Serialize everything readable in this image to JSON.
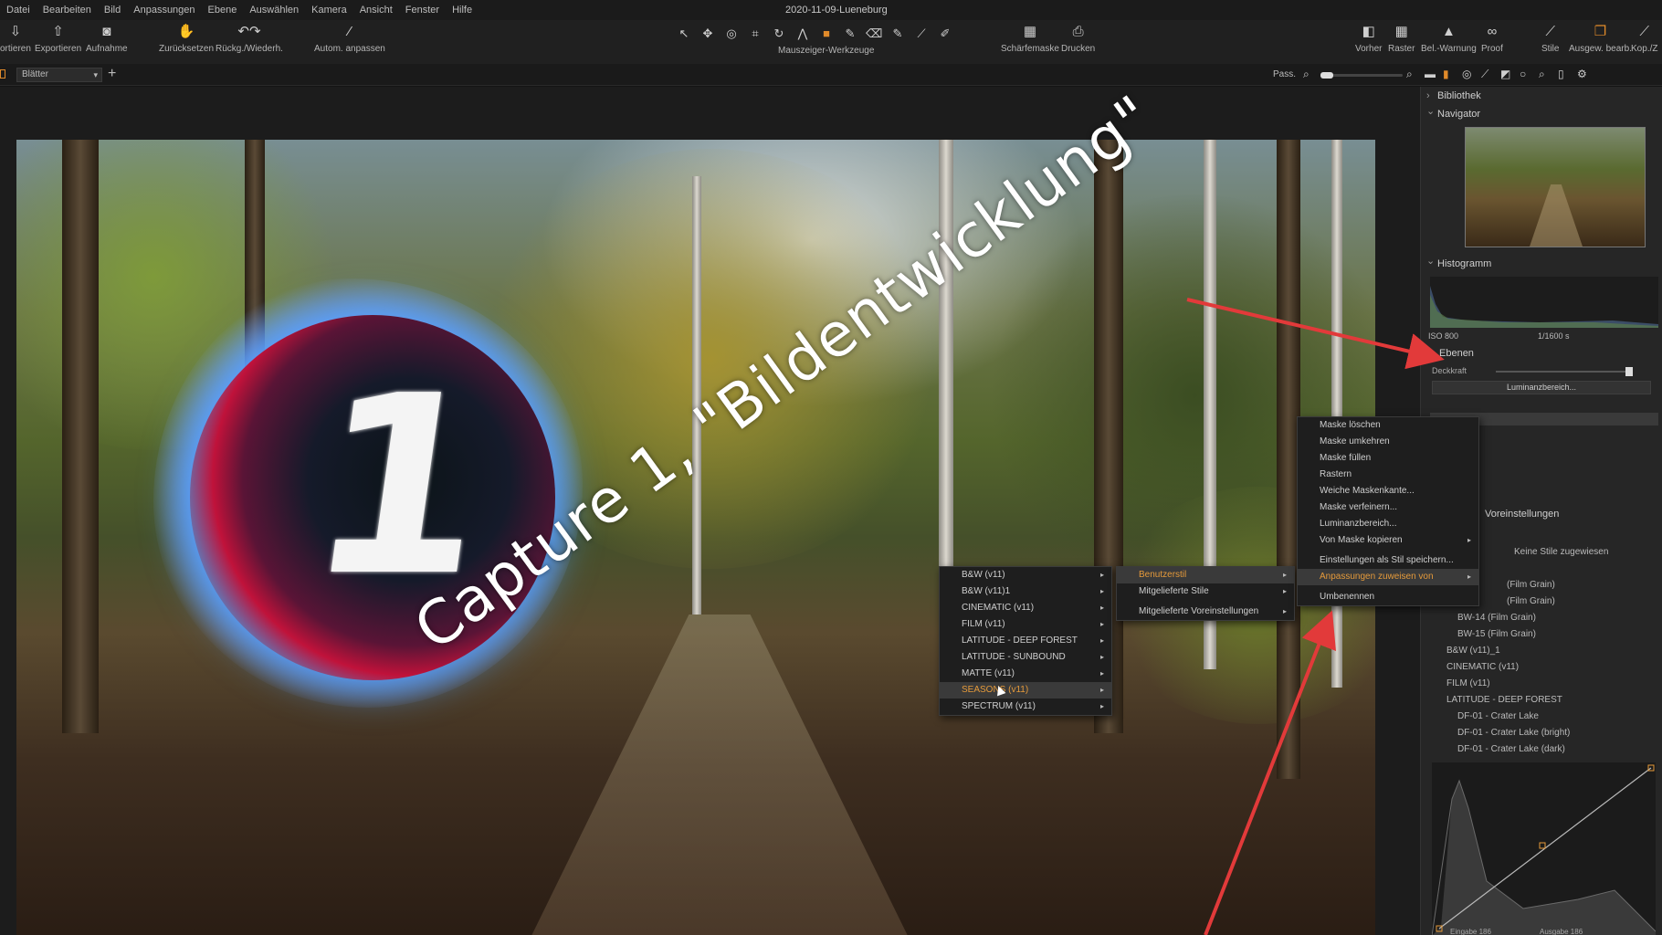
{
  "menubar": {
    "items": [
      "Datei",
      "Bearbeiten",
      "Bild",
      "Anpassungen",
      "Ebene",
      "Auswählen",
      "Kamera",
      "Ansicht",
      "Fenster",
      "Hilfe"
    ],
    "doc_title": "2020-11-09-Lueneburg"
  },
  "toolbar": {
    "import": "ortieren",
    "export": "Exportieren",
    "capture": "Aufnahme",
    "reset": "Zurücksetzen",
    "undo_redo": "Rückg./Wiederh.",
    "auto": "Autom. anpassen",
    "cursor_tools": "Mauszeiger-Werkzeuge",
    "focus_mask": "Schärfemaske",
    "print": "Drucken",
    "before": "Vorher",
    "grid": "Raster",
    "exposure_warning": "Bel.-Warnung",
    "proof": "Proof",
    "styles": "Stile",
    "copy_apply": "Ausgew. bearb.",
    "copy": "Kop./Z"
  },
  "subbar": {
    "viewer_select": "Blätter",
    "fit": "Pass."
  },
  "overlay": {
    "caption": "Capture  1, \"Bildentwicklung\"",
    "logo_digit": "1"
  },
  "panel": {
    "library": "Bibliothek",
    "navigator": "Navigator",
    "histogram": "Histogramm",
    "iso": "ISO 800",
    "shutter": "1/1600 s",
    "layers": "Ebenen",
    "opacity": "Deckkraft",
    "luminance_range": "Luminanzbereich...",
    "presets_title": "Voreinstellungen",
    "no_styles": "Keine Stile zugewiesen",
    "style_items": [
      "(Film Grain)",
      "(Film Grain)",
      "BW-14 (Film Grain)",
      "BW-15 (Film Grain)"
    ],
    "style_groups": [
      "B&W (v11)_1",
      "CINEMATIC (v11)",
      "FILM (v11)"
    ],
    "open_group": "LATITUDE - DEEP FOREST",
    "open_group_items": [
      "DF-01 - Crater Lake",
      "DF-01 - Crater Lake (bright)",
      "DF-01 - Crater Lake (dark)"
    ],
    "curve_input": "Eingabe  186",
    "curve_output": "Ausgabe  186"
  },
  "menu_styles": [
    "B&W (v11)",
    "B&W (v11)1",
    "CINEMATIC (v11)",
    "FILM (v11)",
    "LATITUDE - DEEP FOREST",
    "LATITUDE - SUNBOUND",
    "MATTE (v11)",
    "SEASONS (v11)",
    "SPECTRUM (v11)"
  ],
  "menu_style_groups": [
    "Benutzerstil",
    "Mitgelieferte Stile",
    "Mitgelieferte Voreinstellungen"
  ],
  "menu_mask": [
    "Maske löschen",
    "Maske umkehren",
    "Maske füllen",
    "Rastern",
    "Weiche Maskenkante...",
    "Maske verfeinern...",
    "Luminanzbereich...",
    "Von Maske kopieren",
    "Einstellungen als Stil speichern...",
    "Anpassungen zuweisen von",
    "Umbenennen"
  ],
  "colors": {
    "accent": "#e59a3a",
    "arrow": "#e23a3a",
    "logo_blue": "#5fb8ff",
    "logo_red": "#c0123a"
  }
}
